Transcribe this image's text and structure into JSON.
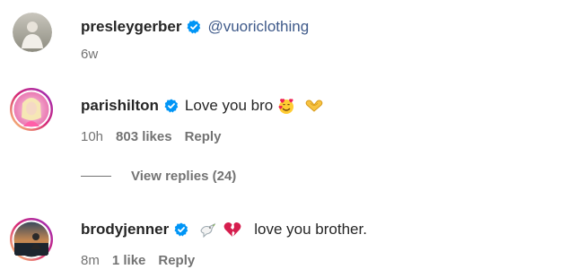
{
  "comments": [
    {
      "username": "presleygerber",
      "verified": true,
      "mention": "@vuoriclothing",
      "text": "",
      "time": "6w",
      "likes": "",
      "reply_label": "",
      "avatar_icon": "presleygerber-avatar"
    },
    {
      "username": "parishilton",
      "verified": true,
      "mention": "",
      "text": "Love you bro",
      "emojis": [
        "smiling-face-with-hearts-emoji",
        "heart-hands-emoji"
      ],
      "time": "10h",
      "likes": "803 likes",
      "reply_label": "Reply",
      "avatar_icon": "parishilton-avatar"
    },
    {
      "username": "brodyjenner",
      "verified": true,
      "mention": "",
      "text": "love you brother.",
      "emojis": [
        "dove-emoji",
        "broken-heart-emoji"
      ],
      "time": "8m",
      "likes": "1 like",
      "reply_label": "Reply",
      "avatar_icon": "brodyjenner-avatar"
    }
  ],
  "view_replies": "View replies (24)",
  "colors": {
    "verified_blue": "#0095f6",
    "meta_gray": "#737373",
    "mention_blue": "#3f5a8a",
    "story_ring_start": "#feda75",
    "story_ring_mid": "#d62976",
    "story_ring_end": "#962fbf"
  }
}
